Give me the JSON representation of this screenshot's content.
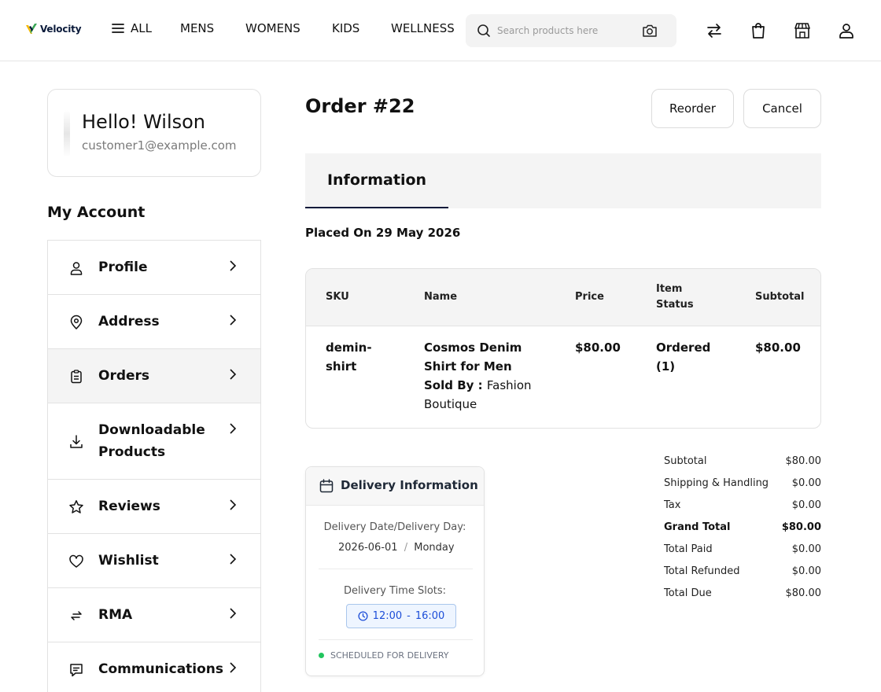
{
  "header": {
    "logo_text": "Velocity",
    "nav": {
      "all": "ALL",
      "mens": "MENS",
      "womens": "WOMENS",
      "kids": "KIDS",
      "wellness": "WELLNESS"
    },
    "search_placeholder": "Search products here",
    "icons": [
      "compare-icon",
      "cart-icon",
      "store-icon",
      "user-icon"
    ]
  },
  "sidebar": {
    "greeting": "Hello! Wilson",
    "email": "customer1@example.com",
    "section_title": "My Account",
    "items": [
      {
        "label": "Profile",
        "icon": "user-icon"
      },
      {
        "label": "Address",
        "icon": "location-pin-icon"
      },
      {
        "label": "Orders",
        "icon": "clipboard-icon",
        "active": true
      },
      {
        "label": "Downloadable Products",
        "line1": "Downloadable",
        "line2": "Products",
        "icon": "download-icon"
      },
      {
        "label": "Reviews",
        "icon": "star-icon"
      },
      {
        "label": "Wishlist",
        "icon": "heart-icon"
      },
      {
        "label": "RMA",
        "icon": "return-arrows-icon"
      },
      {
        "label": "Communications",
        "icon": "message-icon"
      }
    ]
  },
  "order": {
    "title": "Order #22",
    "reorder_label": "Reorder",
    "cancel_label": "Cancel",
    "tab_information": "Information",
    "placed_on": "Placed On 29 May 2026",
    "table": {
      "headers": {
        "sku": "SKU",
        "name": "Name",
        "price": "Price",
        "status_line1": "Item",
        "status_line2": "Status",
        "subtotal": "Subtotal"
      },
      "rows": [
        {
          "sku_line1": "demin-",
          "sku_line2": "shirt",
          "name_line1": "Cosmos Denim",
          "name_line2": "Shirt for Men",
          "sold_by_label": "Sold By :",
          "seller_part1": "Fashion",
          "seller_part2": "Boutique",
          "price": "$80.00",
          "status_line1": "Ordered",
          "status_line2": "(1)",
          "subtotal": "$80.00"
        }
      ]
    },
    "totals": [
      {
        "label": "Subtotal",
        "value": "$80.00"
      },
      {
        "label": "Shipping & Handling",
        "value": "$0.00"
      },
      {
        "label": "Tax",
        "value": "$0.00"
      },
      {
        "label": "Grand Total",
        "value": "$80.00",
        "bold": true
      },
      {
        "label": "Total Paid",
        "value": "$0.00"
      },
      {
        "label": "Total Refunded",
        "value": "$0.00"
      },
      {
        "label": "Total Due",
        "value": "$80.00"
      }
    ],
    "delivery": {
      "title": "Delivery Information",
      "date_label": "Delivery Date/Delivery Day:",
      "date": "2026-06-01",
      "separator": "/",
      "day": "Monday",
      "slots_label": "Delivery Time Slots:",
      "slot_start": "12:00",
      "slot_dash": "-",
      "slot_end": "16:00",
      "status": "SCHEDULED FOR DELIVERY"
    }
  },
  "colors": {
    "accent_dark": "#0a1a3a",
    "logo_yellow": "#f5b800",
    "logo_green": "#3aa655",
    "slot_blue": "#1d4ed8",
    "status_green": "#22c55e"
  }
}
